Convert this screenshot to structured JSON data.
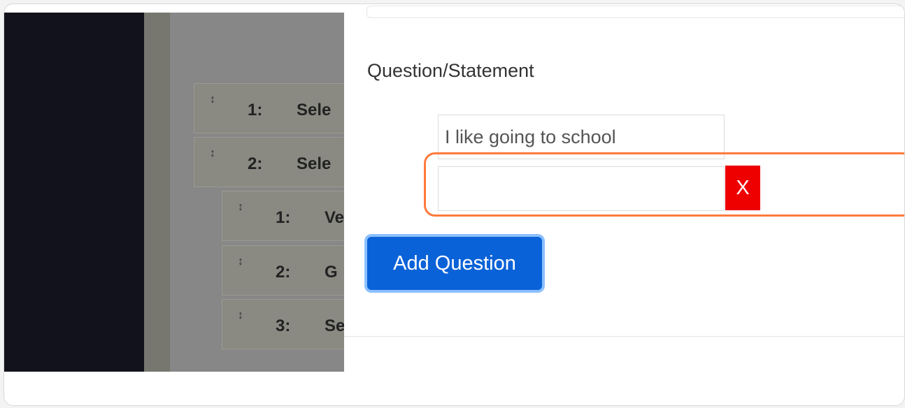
{
  "background_list": {
    "rows": [
      {
        "handle": "↕",
        "number": "1:",
        "label": "Sele"
      },
      {
        "handle": "↕",
        "number": "2:",
        "label": "Sele"
      },
      {
        "handle": "↕",
        "number": "1:",
        "label": "Ve"
      },
      {
        "handle": "↕",
        "number": "2:",
        "label": "G"
      },
      {
        "handle": "↕",
        "number": "3:",
        "label": "Se"
      }
    ]
  },
  "question_panel": {
    "label": "Question/Statement",
    "answers": [
      {
        "value": "I like going to school"
      },
      {
        "value": ""
      }
    ],
    "remove_label": "X",
    "add_question_label": "Add Question"
  },
  "colors": {
    "highlight": "#ff7a3d",
    "remove_button": "#ee0000",
    "add_button": "#0a62d8",
    "sidebar": "#12121c"
  }
}
